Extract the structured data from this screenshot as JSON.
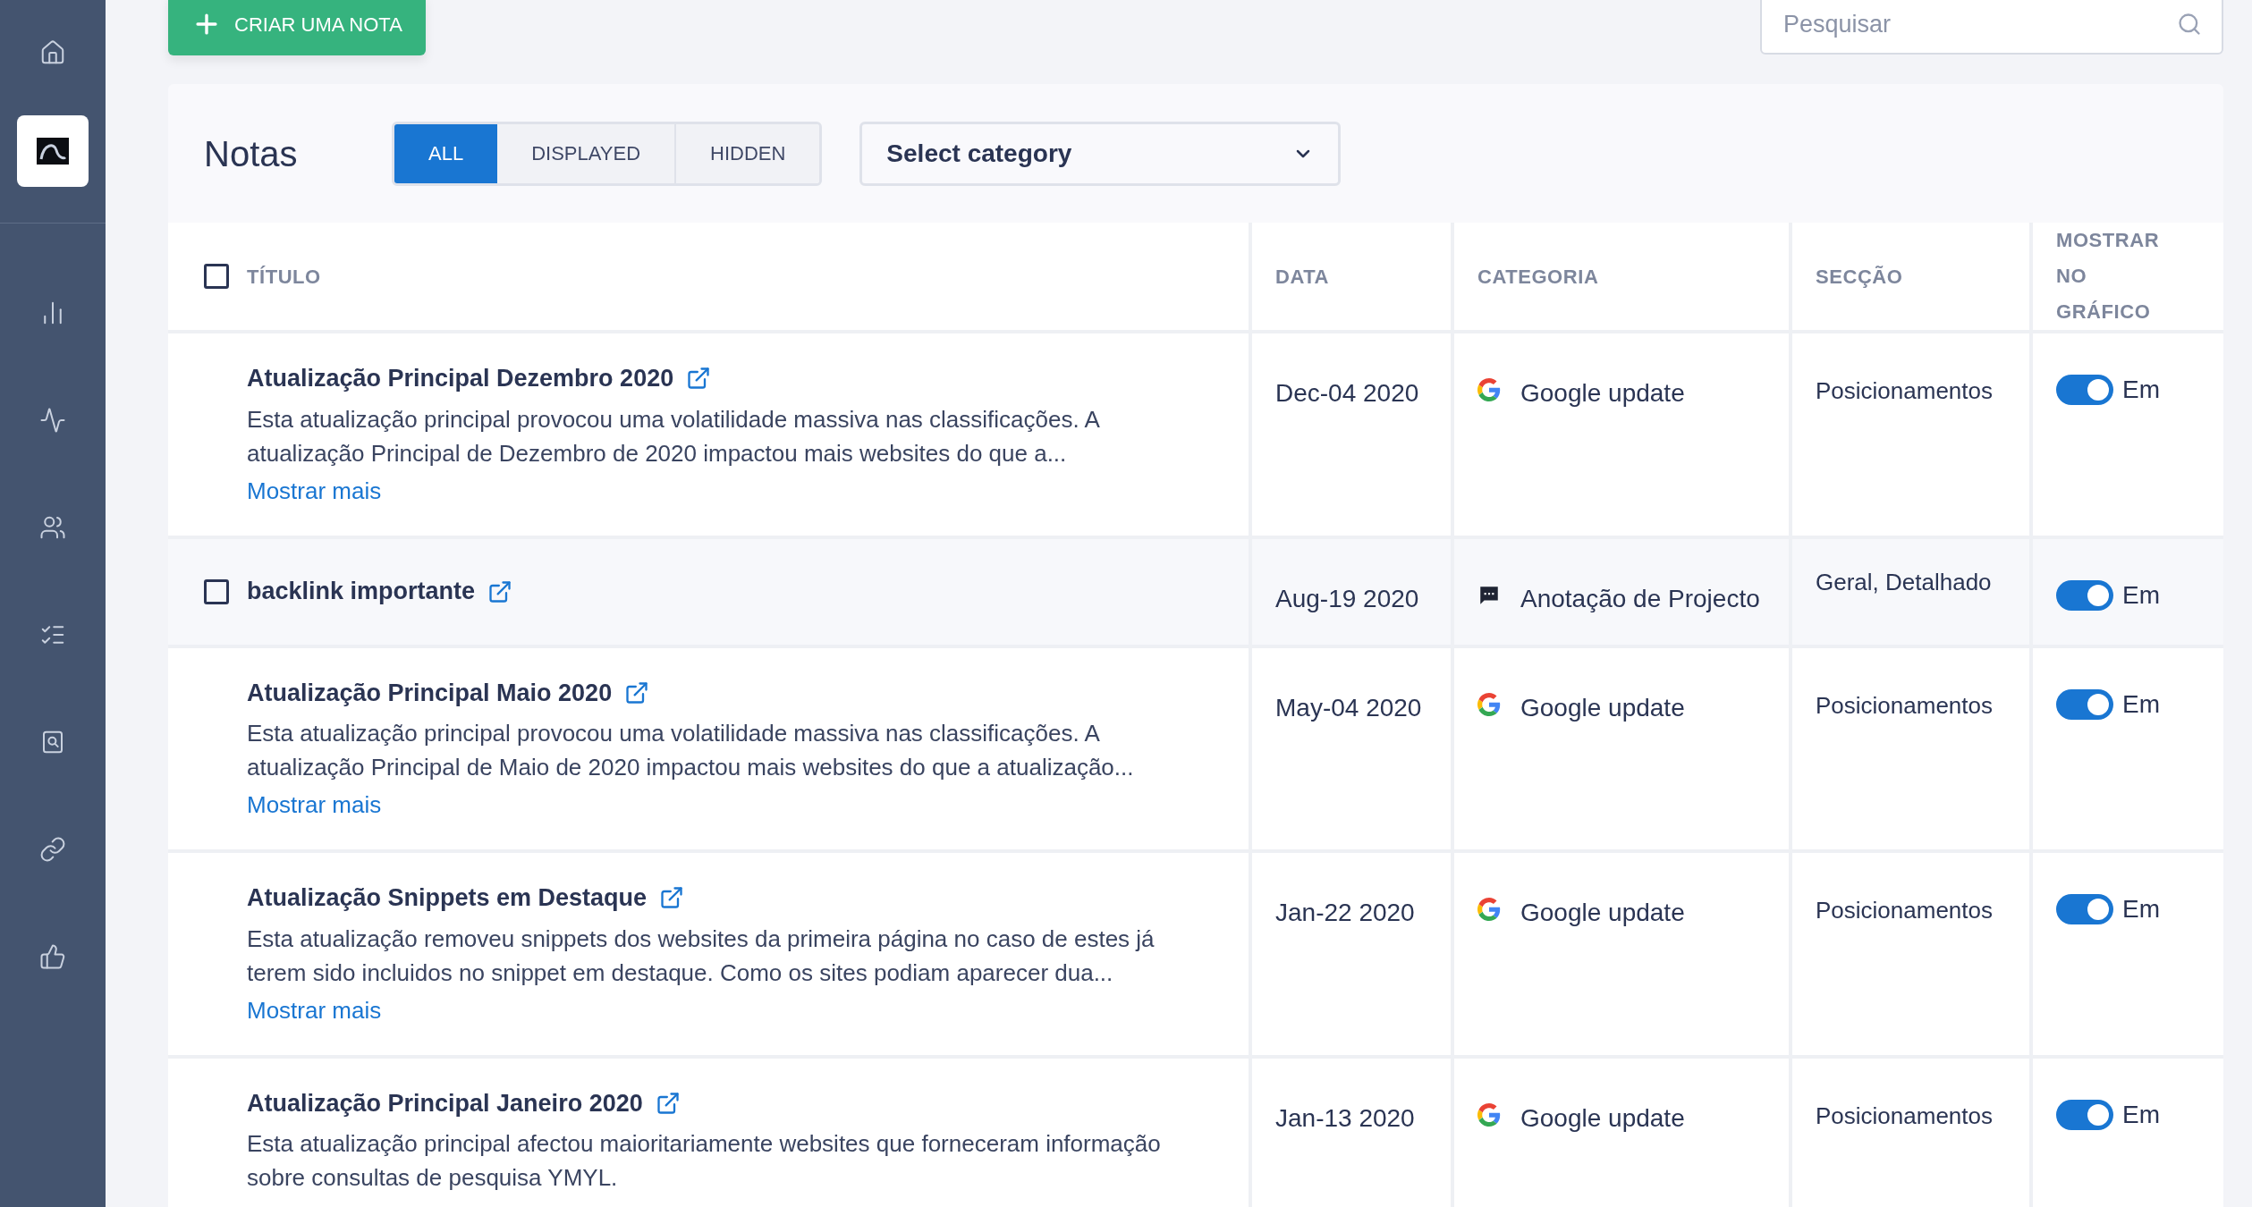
{
  "create_button": {
    "label": "CRIAR UMA NOTA"
  },
  "search": {
    "placeholder": "Pesquisar"
  },
  "panel": {
    "title": "Notas"
  },
  "filter_tabs": [
    {
      "label": "ALL",
      "selected": true
    },
    {
      "label": "DISPLAYED",
      "selected": false
    },
    {
      "label": "HIDDEN",
      "selected": false
    }
  ],
  "category_select": {
    "value": "Select category"
  },
  "select_all": {
    "checked": false
  },
  "table": {
    "columns": [
      "TÍTULO",
      "DATA",
      "CATEGORIA",
      "SECÇÃO",
      "MOSTRAR NO GRÁFICO"
    ],
    "rows": [
      {
        "hovered": false,
        "checked": false,
        "title": "Atualização Principal Dezembro 2020",
        "description": "Esta atualização principal provocou uma volatilidade massiva nas classificações. A atualização Principal de Dezembro de 2020 impactou mais websites do que a...",
        "more": "Mostrar mais",
        "date": "Dec-04 2020",
        "kind": "google",
        "category": "Google update",
        "section": "Posicionamentos",
        "on": true,
        "toggle_label": "Em"
      },
      {
        "hovered": true,
        "checked": false,
        "title": "backlink importante",
        "date": "Aug-19 2020",
        "kind": "project",
        "category": "Anotação de Projecto",
        "section": "Geral, Detalhado",
        "on": true,
        "toggle_label": "Em"
      },
      {
        "hovered": false,
        "checked": false,
        "title": "Atualização Principal Maio 2020",
        "description": "Esta atualização principal provocou uma volatilidade massiva nas classificações. A atualização Principal de Maio de 2020 impactou mais websites do que a atualização...",
        "more": "Mostrar mais",
        "date": "May-04 2020",
        "kind": "google",
        "category": "Google update",
        "section": "Posicionamentos",
        "on": true,
        "toggle_label": "Em"
      },
      {
        "hovered": false,
        "checked": false,
        "title": "Atualização Snippets em Destaque",
        "description": "Esta atualização removeu snippets dos websites da primeira página no caso de estes já terem sido incluidos no snippet em destaque. Como os sites podiam aparecer dua...",
        "more": "Mostrar mais",
        "date": "Jan-22 2020",
        "kind": "google",
        "category": "Google update",
        "section": "Posicionamentos",
        "on": true,
        "toggle_label": "Em"
      },
      {
        "hovered": false,
        "checked": false,
        "title": "Atualização Principal Janeiro 2020",
        "description": "Esta atualização principal afectou maioritariamente websites que forneceram informação sobre consultas de pesquisa YMYL.",
        "date": "Jan-13 2020",
        "kind": "google",
        "category": "Google update",
        "section": "Posicionamentos",
        "on": true,
        "toggle_label": "Em"
      }
    ]
  }
}
